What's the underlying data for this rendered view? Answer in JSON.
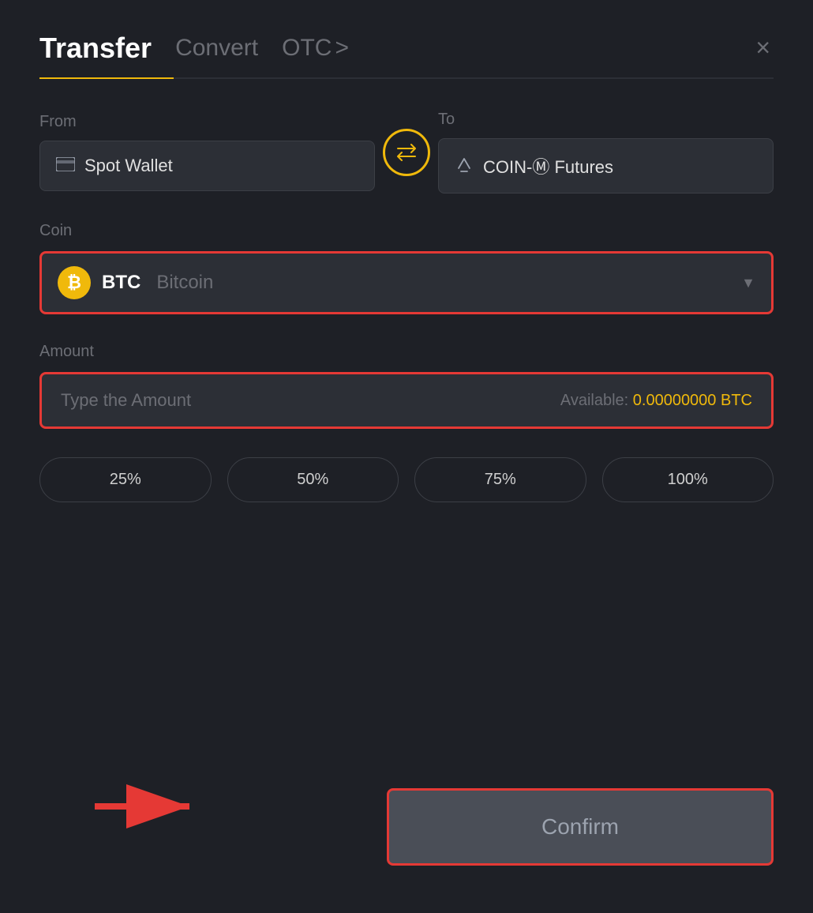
{
  "header": {
    "tab_transfer": "Transfer",
    "tab_convert": "Convert",
    "tab_otc": "OTC",
    "tab_otc_chevron": ">",
    "close_label": "×"
  },
  "from": {
    "label": "From",
    "wallet_name": "Spot Wallet"
  },
  "to": {
    "label": "To",
    "wallet_name": "COIN-Ⓜ Futures"
  },
  "coin": {
    "label": "Coin",
    "symbol": "BTC",
    "name": "Bitcoin"
  },
  "amount": {
    "label": "Amount",
    "placeholder": "Type the Amount",
    "available_label": "Available:",
    "available_value": "0.00000000 BTC"
  },
  "percentage_buttons": [
    {
      "label": "25%"
    },
    {
      "label": "50%"
    },
    {
      "label": "75%"
    },
    {
      "label": "100%"
    }
  ],
  "confirm_button": {
    "label": "Confirm"
  }
}
